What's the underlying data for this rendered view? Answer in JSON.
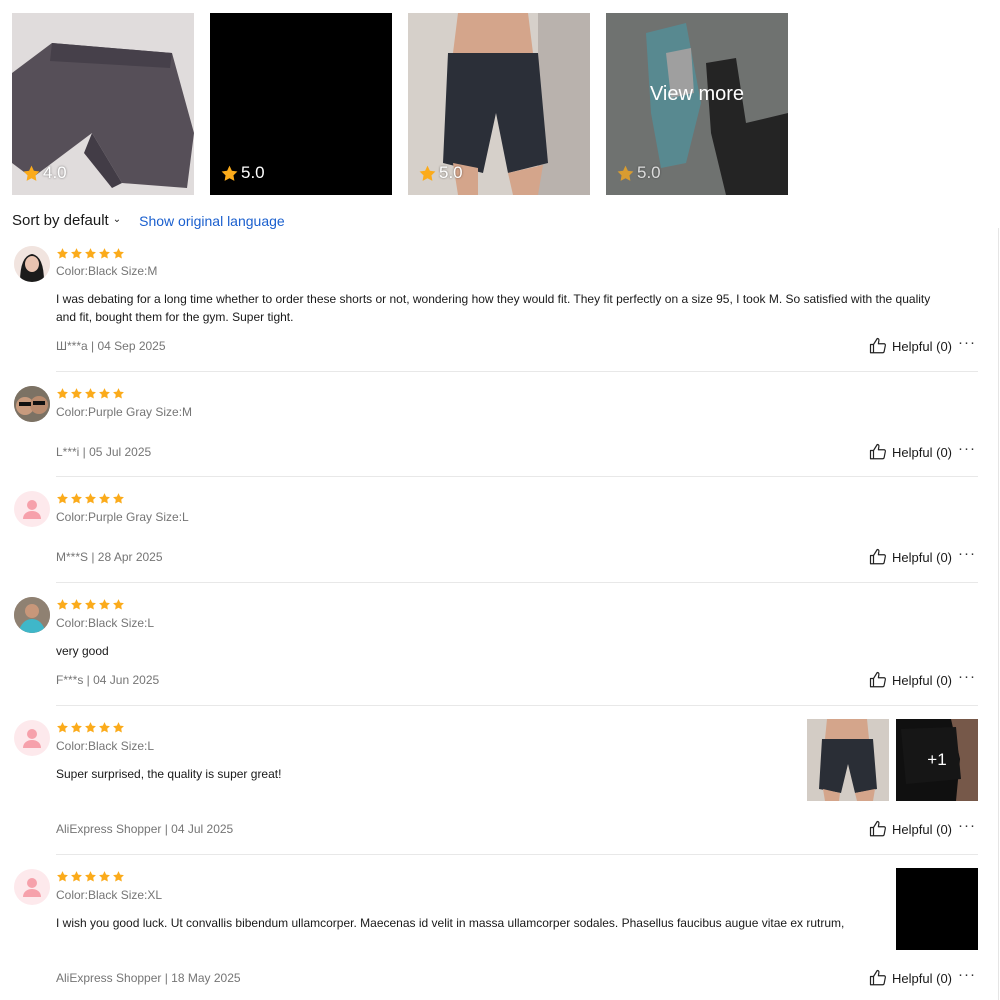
{
  "gallery": [
    {
      "rating": "4.0",
      "kind": "shorts-flat"
    },
    {
      "rating": "5.0",
      "kind": "black"
    },
    {
      "rating": "5.0",
      "kind": "person-shorts"
    },
    {
      "rating": "5.0",
      "kind": "sneaker",
      "overlay": "View more"
    }
  ],
  "sort": {
    "label": "Sort by default",
    "show_language": "Show original language"
  },
  "colors": {
    "star": "#fbab1b",
    "link": "#1a5fce"
  },
  "reviews": [
    {
      "stars": 5,
      "meta": "Color:Black Size:M",
      "text": "I was debating for a long time whether to order these shorts or not, wondering how they would fit. They fit perfectly on a size 95, I took M. So satisfied with the quality and fit, bought them for the gym. Super tight.",
      "byline": "Ш***а | 04 Sep 2025",
      "helpful": "Helpful (0)"
    },
    {
      "stars": 5,
      "meta": "Color:Purple Gray Size:M",
      "text": "",
      "byline": "L***i | 05 Jul 2025",
      "helpful": "Helpful (0)"
    },
    {
      "stars": 5,
      "meta": "Color:Purple Gray Size:L",
      "text": "",
      "byline": "M***S | 28 Apr 2025",
      "helpful": "Helpful (0)"
    },
    {
      "stars": 5,
      "meta": "Color:Black Size:L",
      "text": "very good",
      "byline": "F***s | 04 Jun 2025",
      "helpful": "Helpful (0)"
    },
    {
      "stars": 5,
      "meta": "Color:Black Size:L",
      "text": "Super surprised, the quality is super great!",
      "byline": "AliExpress Shopper | 04 Jul 2025",
      "helpful": "Helpful (0)",
      "extra_images": "+1"
    },
    {
      "stars": 5,
      "meta": "Color:Black Size:XL",
      "text": "I wish you good luck. Ut convallis bibendum ullamcorper. Maecenas id velit in massa ullamcorper sodales. Phasellus faucibus augue vitae ex rutrum,",
      "byline": "AliExpress Shopper | 18 May 2025",
      "helpful": "Helpful (0)"
    }
  ]
}
